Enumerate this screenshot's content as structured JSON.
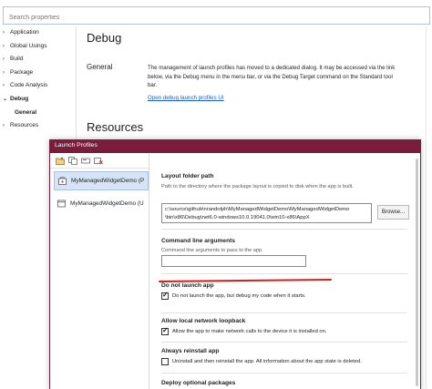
{
  "search": {
    "placeholder": "Search properties"
  },
  "nav": {
    "items": [
      {
        "label": "Application",
        "expandable": true
      },
      {
        "label": "Global Usings",
        "expandable": true
      },
      {
        "label": "Build",
        "expandable": true
      },
      {
        "label": "Package",
        "expandable": true
      },
      {
        "label": "Code Analysis",
        "expandable": true
      },
      {
        "label": "Debug",
        "expandable": true,
        "expanded": true
      },
      {
        "label": "General",
        "child": true,
        "selected": true
      },
      {
        "label": "Resources",
        "expandable": true
      }
    ]
  },
  "page": {
    "title": "Debug",
    "section_label": "General",
    "description": "The management of launch profiles has moved to a dedicated dialog. It may be accessed via the link below, via the Debug menu in the menu bar, or via the Debug Target command on the Standard tool bar.",
    "link": "Open debug launch profiles UI",
    "next_title": "Resources"
  },
  "dialog": {
    "title": "Launch Profiles",
    "accent_color": "#7a1c3c",
    "toolbar_icons": [
      "new-profile-icon",
      "copy-profile-icon",
      "rename-profile-icon",
      "delete-profile-icon"
    ],
    "profiles": [
      {
        "label": "MyManagedWidgetDemo (P",
        "icon": "package-icon",
        "selected": true
      },
      {
        "label": "MyManagedWidgetDemo (U",
        "icon": "window-icon",
        "selected": false
      }
    ],
    "layout_folder": {
      "title": "Layout folder path",
      "desc": "Path to the directory where the package layout is copied to disk when the app is built.",
      "value_line1": "c:\\source\\github\\nrandolph\\MyManagedWidgetDemo\\MyManagedWidgetDemo",
      "value_line2": "\\bin\\x86\\Debug\\net6.0-windows10.0.19041.0\\win10-x86\\AppX",
      "browse": "Browse..."
    },
    "cmd_args": {
      "title": "Command line arguments",
      "desc": "Command line arguments to pass to the app.",
      "value": ""
    },
    "do_not_launch": {
      "title": "Do not launch app",
      "label": "Do not launch the app, but debug my code when it starts.",
      "checked": true
    },
    "loopback": {
      "title": "Allow local network loopback",
      "label": "Allow the app to make network calls to the device it is installed on.",
      "checked": true
    },
    "reinstall": {
      "title": "Always reinstall app",
      "label": "Uninstall and then reinstall the app. All information about the app state is deleted.",
      "checked": false
    },
    "optional_packages": {
      "title": "Deploy optional packages"
    },
    "highlight_color": "#d11f1f"
  }
}
